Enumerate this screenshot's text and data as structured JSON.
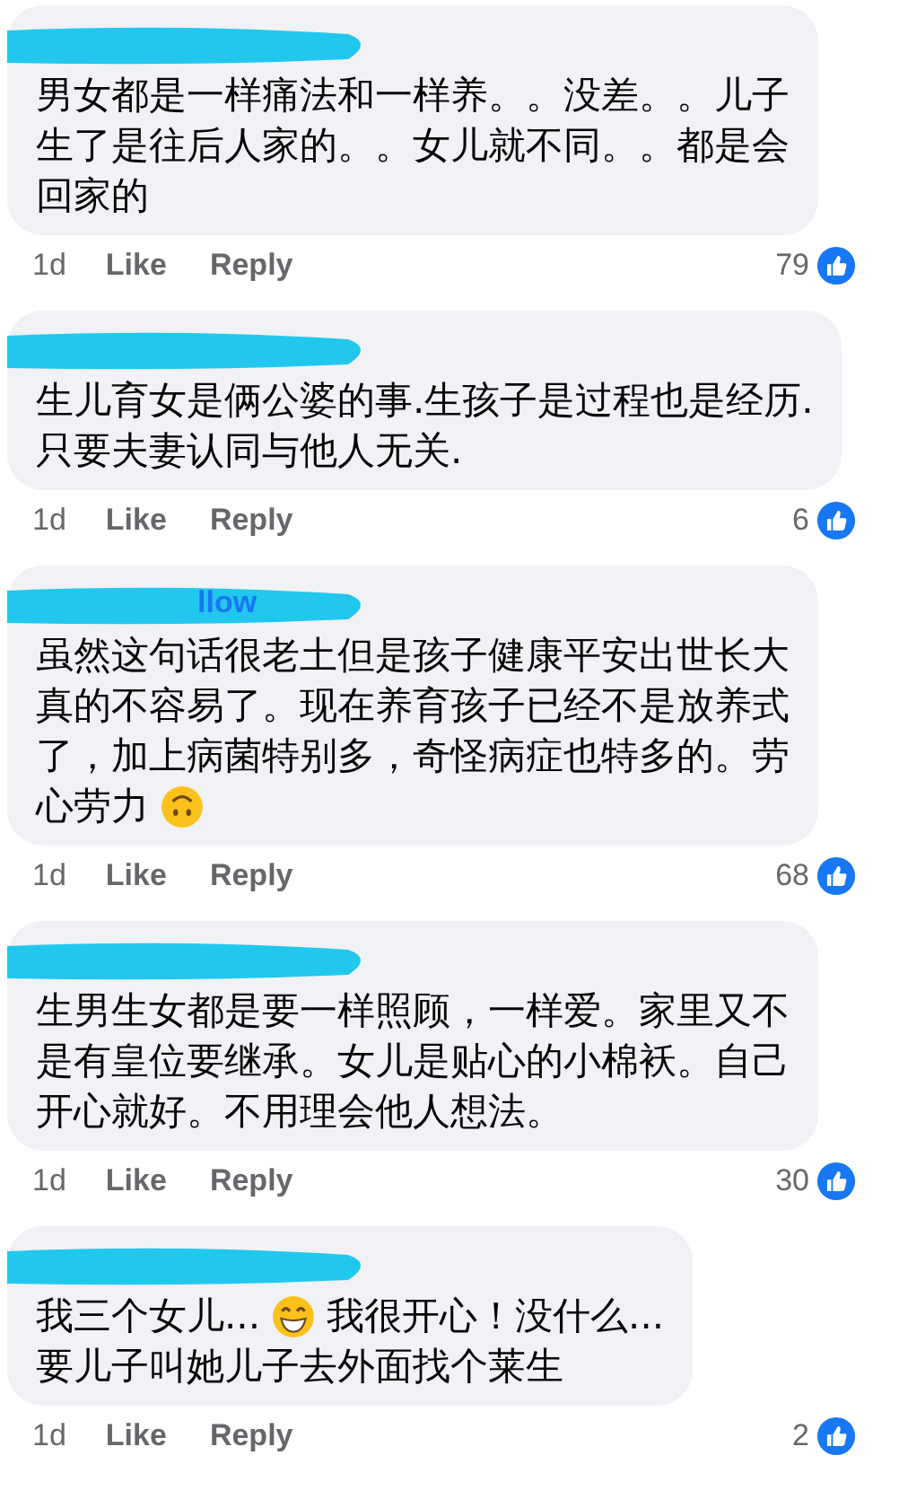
{
  "comments": [
    {
      "lines": [
        [
          {
            "kind": "text",
            "text": "男女都是一样痛法和一样养。。没差。。儿子"
          }
        ],
        [
          {
            "kind": "text",
            "text": "生了是往后人家的。。女儿就不同。。都是会"
          }
        ],
        [
          {
            "kind": "text",
            "text": "回家的"
          }
        ]
      ],
      "time": "1d",
      "like": "Like",
      "reply": "Reply",
      "reactions": "79"
    },
    {
      "lines": [
        [
          {
            "kind": "text",
            "text": "生儿育女是俩公婆的事.生孩子是过程也是经历."
          }
        ],
        [
          {
            "kind": "text",
            "text": "只要夫妻认同与他人无关."
          }
        ]
      ],
      "time": "1d",
      "like": "Like",
      "reply": "Reply",
      "reactions": "6"
    },
    {
      "author_fragment": "llow",
      "lines": [
        [
          {
            "kind": "text",
            "text": "虽然这句话很老土但是孩子健康平安出世长大"
          }
        ],
        [
          {
            "kind": "text",
            "text": "真的不容易了。现在养育孩子已经不是放养式"
          }
        ],
        [
          {
            "kind": "text",
            "text": "了，加上病菌特别多，奇怪病症也特多的。劳"
          }
        ],
        [
          {
            "kind": "text",
            "text": "心劳力"
          },
          {
            "kind": "upside"
          }
        ]
      ],
      "time": "1d",
      "like": "Like",
      "reply": "Reply",
      "reactions": "68"
    },
    {
      "lines": [
        [
          {
            "kind": "text",
            "text": "生男生女都是要一样照顾，一样爱。家里又不"
          }
        ],
        [
          {
            "kind": "text",
            "text": "是有皇位要继承。女儿是贴心的小棉袄。自己"
          }
        ],
        [
          {
            "kind": "text",
            "text": "开心就好。不用理会他人想法。"
          }
        ]
      ],
      "time": "1d",
      "like": "Like",
      "reply": "Reply",
      "reactions": "30"
    },
    {
      "lines": [
        [
          {
            "kind": "text",
            "text": "我三个女儿..."
          },
          {
            "kind": "grin"
          },
          {
            "kind": "text",
            "text": "我很开心！没什么..."
          }
        ],
        [
          {
            "kind": "text",
            "text": "要儿子叫她儿子去外面找个莱生"
          }
        ]
      ],
      "time": "1d",
      "like": "Like",
      "reply": "Reply",
      "reactions": "2"
    }
  ]
}
